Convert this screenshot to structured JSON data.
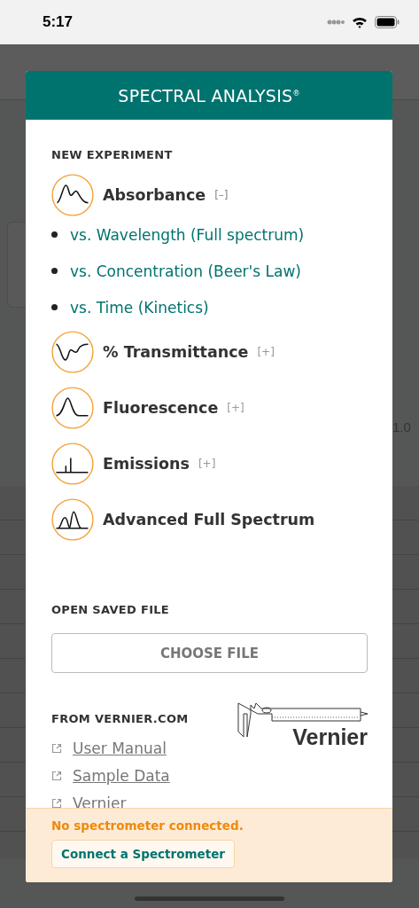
{
  "status_bar": {
    "time": "5:17"
  },
  "background": {
    "axis_label": "1.0"
  },
  "dialog": {
    "title": "SPECTRAL ANALYSIS",
    "title_mark": "®",
    "new_experiment": {
      "heading": "NEW EXPERIMENT",
      "modes": [
        {
          "kind": "peaks",
          "label": "Absorbance",
          "toggle": "[–]",
          "expanded": true,
          "children": [
            "vs. Wavelength (Full spectrum)",
            "vs. Concentration (Beer's Law)",
            "vs. Time (Kinetics)"
          ]
        },
        {
          "kind": "dip",
          "label": "% Transmittance",
          "toggle": "[+]",
          "expanded": false
        },
        {
          "kind": "peak",
          "label": "Fluorescence",
          "toggle": "[+]",
          "expanded": false
        },
        {
          "kind": "lines",
          "label": "Emissions",
          "toggle": "[+]",
          "expanded": false
        },
        {
          "kind": "double",
          "label": "Advanced Full Spectrum"
        }
      ]
    },
    "open_saved": {
      "heading": "OPEN SAVED FILE",
      "button": "CHOOSE FILE"
    },
    "from_vernier": {
      "heading": "FROM VERNIER.COM",
      "links": [
        "User Manual",
        "Sample Data",
        "Vernier"
      ],
      "logo_text": "Vernier"
    },
    "footer": {
      "message": "No spectrometer connected.",
      "button": "Connect a Spectrometer"
    }
  }
}
